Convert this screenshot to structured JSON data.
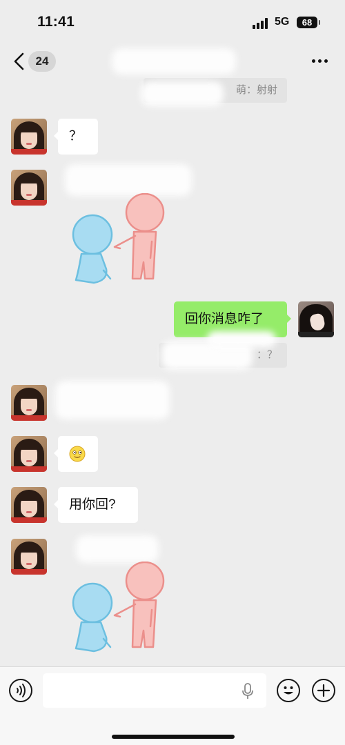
{
  "status_bar": {
    "time": "11:41",
    "network": "5G",
    "battery": "68"
  },
  "nav": {
    "unread_count": "24"
  },
  "system_notes": {
    "first": "萌：射射",
    "second": "：？"
  },
  "messages": {
    "m1": "？",
    "m3": "回你消息咋了",
    "m6": "用你回?"
  },
  "icons": {
    "back": "chevron-left-icon",
    "more": "more-dots-icon",
    "voice": "voice-icon",
    "mic": "mic-icon",
    "emoji": "emoji-icon",
    "add": "add-icon",
    "sticker": "sticker-pointing-figures"
  },
  "colors": {
    "background": "#ededed",
    "self_bubble": "#95ec69",
    "other_bubble": "#ffffff"
  }
}
